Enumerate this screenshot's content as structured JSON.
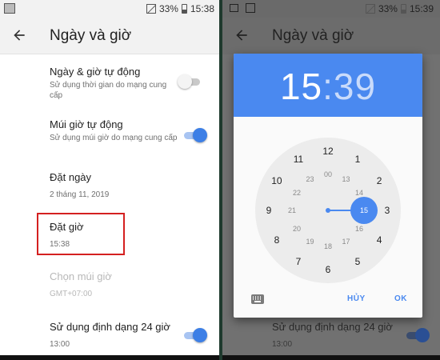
{
  "left": {
    "status": {
      "battery": "33%",
      "time": "15:38"
    },
    "app_title": "Ngày và giờ",
    "settings": [
      {
        "title": "Ngày & giờ tự động",
        "subtitle": "Sử dụng thời gian do mạng cung cấp",
        "toggle": false
      },
      {
        "title": "Múi giờ tự động",
        "subtitle": "Sử dụng múi giờ do mạng cung cấp",
        "toggle": true
      },
      {
        "title": "Đặt ngày",
        "subtitle": "2 tháng 11, 2019"
      },
      {
        "title": "Đặt giờ",
        "subtitle": "15:38"
      },
      {
        "title": "Chọn múi giờ",
        "subtitle": "GMT+07:00",
        "disabled": true
      },
      {
        "title": "Sử dụng định dạng 24 giờ",
        "subtitle": "13:00",
        "toggle": true
      }
    ]
  },
  "right": {
    "status": {
      "battery": "33%",
      "time": "15:39"
    },
    "app_title": "Ngày và giờ",
    "bg_setting": {
      "title": "Sử dụng định dạng 24 giờ",
      "subtitle": "13:00"
    },
    "dialog": {
      "time_hour": "15",
      "time_sep": ":",
      "time_min": "39",
      "outer_hours": [
        "12",
        "1",
        "2",
        "3",
        "4",
        "5",
        "6",
        "7",
        "8",
        "9",
        "10",
        "11"
      ],
      "inner_hours": [
        "00",
        "13",
        "14",
        "15",
        "16",
        "17",
        "18",
        "19",
        "20",
        "21",
        "22",
        "23"
      ],
      "selected_hour": "15",
      "cancel_label": "HỦY",
      "ok_label": "OK",
      "accent_color": "#4a89f0"
    }
  }
}
